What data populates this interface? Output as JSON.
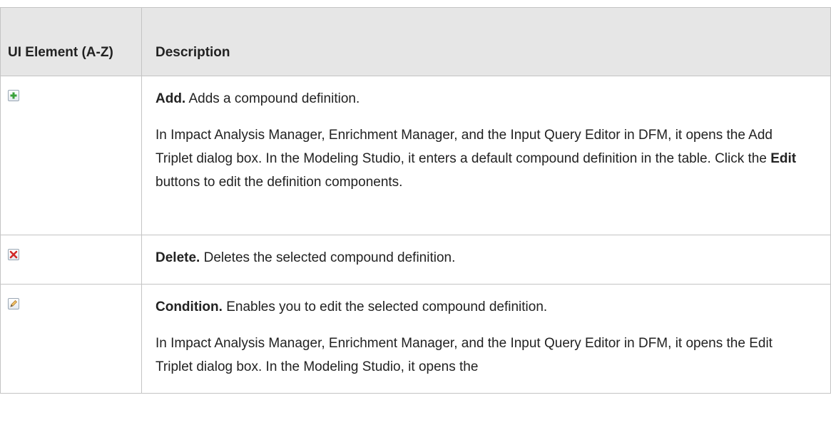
{
  "table": {
    "header": {
      "element": "UI Element (A-Z)",
      "description": "Description"
    },
    "rows": [
      {
        "icon": "add-plus-icon",
        "title": "Add.",
        "text": "Adds a compound definition.",
        "paragraph2": {
          "before": "In Impact Analysis Manager, Enrichment Manager, and the Input Query Editor in DFM, it opens the Add Triplet dialog box. In the Modeling Studio, it enters a default compound definition in the table. Click the ",
          "bold": "Edit",
          "after": " buttons to edit the definition components."
        }
      },
      {
        "icon": "delete-x-icon",
        "title": "Delete.",
        "text": "Deletes the selected compound definition."
      },
      {
        "icon": "edit-pencil-icon",
        "title": "Condition.",
        "text": "Enables you to edit the selected compound definition.",
        "paragraph2": {
          "before": "In Impact Analysis Manager, Enrichment Manager, and the Input Query Editor in DFM, it opens the Edit Triplet dialog box. In the Modeling Studio, it opens the"
        }
      }
    ]
  },
  "colors": {
    "header_bg": "#e6e6e6",
    "border": "#c4c4c4",
    "add_green": "#3aa13a",
    "delete_red": "#d22a2a",
    "pencil_orange": "#e0a040"
  }
}
